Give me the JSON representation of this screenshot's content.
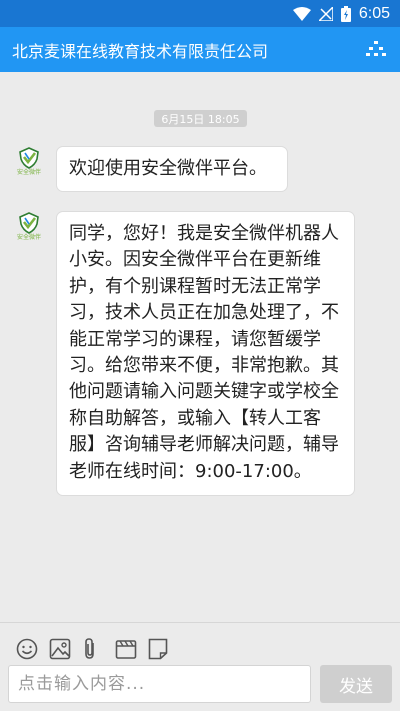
{
  "status_bar": {
    "time": "6:05"
  },
  "app_bar": {
    "title": "北京麦课在线教育技术有限责任公司"
  },
  "chat": {
    "timestamp": "6月15日 18:05",
    "avatar_caption": "安全微伴",
    "messages": [
      {
        "text": "欢迎使用安全微伴平台。"
      },
      {
        "text": "同学，您好！我是安全微伴机器人小安。因安全微伴平台在更新维护，有个别课程暂时无法正常学习，技术人员正在加急处理了，不能正常学习的课程，请您暂缓学习。给您带来不便，非常抱歉。其他问题请输入问题关键字或学校全称自助解答，或输入【转人工客服】咨询辅导老师解决问题，辅导老师在线时间：9:00-17:00。"
      }
    ]
  },
  "composer": {
    "placeholder": "点击输入内容...",
    "send_label": "发送"
  },
  "icons": {
    "wifi": "wifi-icon",
    "signal": "signal-icon",
    "battery": "battery-charging-icon",
    "menu": "menu-icon",
    "emoji": "emoji-icon",
    "image": "image-icon",
    "attach": "attachment-icon",
    "video": "video-icon",
    "note": "note-icon"
  },
  "colors": {
    "status_bar": "#1976d2",
    "app_bar": "#2196f3",
    "background": "#ebebeb"
  }
}
